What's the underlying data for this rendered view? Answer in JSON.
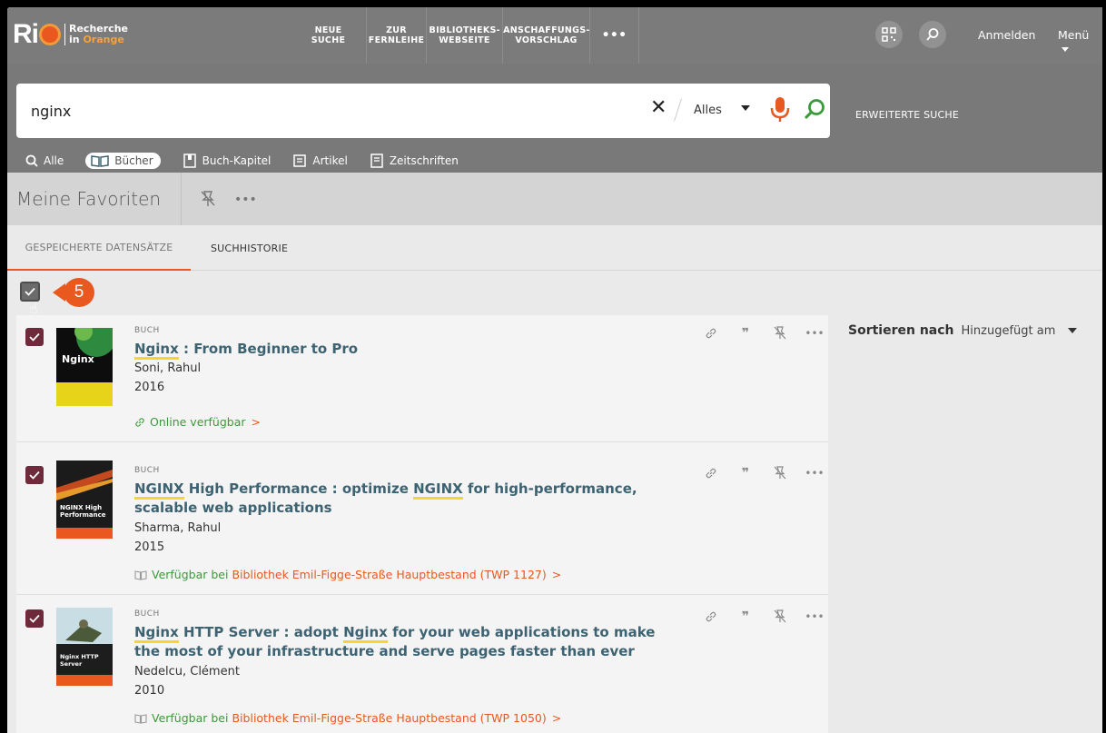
{
  "logo": {
    "brand": "Ri",
    "line1": "Recherche",
    "line2_prefix": "in ",
    "line2_accent": "Orange"
  },
  "nav": {
    "links": [
      "NEUE SUCHE",
      "ZUR FERNLEIHE",
      "BIBLIOTHEKS-WEBSEITE",
      "ANSCHAFFUNGS-VORSCHLAG"
    ],
    "more": "•••",
    "login": "Anmelden",
    "menu": "Menü"
  },
  "search": {
    "query": "nginx",
    "clear": "✕",
    "scope": "Alles",
    "advanced": "ERWEITERTE SUCHE"
  },
  "filters": [
    "Alle",
    "Bücher",
    "Buch-Kapitel",
    "Artikel",
    "Zeitschriften"
  ],
  "favorites": {
    "title": "Meine Favoriten",
    "more": "•••"
  },
  "tabs": {
    "saved": "GESPEICHERTE DATENSÄTZE",
    "history": "SUCHHISTORIE"
  },
  "callout": {
    "number": "5"
  },
  "records": [
    {
      "type": "BUCH",
      "title_hl1": "Nginx",
      "title_rest": " : From Beginner to Pro",
      "author": "Soni, Rahul",
      "year": "2016",
      "availability": "Online verfügbar",
      "library": "",
      "cover_text": "Nginx"
    },
    {
      "type": "BUCH",
      "title_hl1": "NGINX",
      "title_mid": " High Performance : optimize ",
      "title_hl2": "NGINX",
      "title_rest": " for high-performance, scalable web applications",
      "author": "Sharma, Rahul",
      "year": "2015",
      "availability": "Verfügbar bei",
      "library": "Bibliothek Emil-Figge-Straße  Hauptbestand (TWP 1127)",
      "cover_text": "NGINX High Performance"
    },
    {
      "type": "BUCH",
      "title_hl1": "Nginx",
      "title_mid": " HTTP Server : adopt ",
      "title_hl2": "Nginx",
      "title_rest": " for your web applications to make the most of your infrastructure and serve pages faster than ever",
      "author": "Nedelcu, Clément",
      "year": "2010",
      "availability": "Verfügbar bei",
      "library": "Bibliothek Emil-Figge-Straße  Hauptbestand (TWP 1050)",
      "cover_text": "Nginx HTTP Server"
    }
  ],
  "record_actions": {
    "more": "•••"
  },
  "sort": {
    "label": "Sortieren nach",
    "value": "Hinzugefügt am"
  },
  "colors": {
    "accent": "#e8581f",
    "checkbox": "#6e2a3a",
    "title": "#3d6372",
    "available": "#3a9a3a",
    "highlight": "#f6d431"
  }
}
